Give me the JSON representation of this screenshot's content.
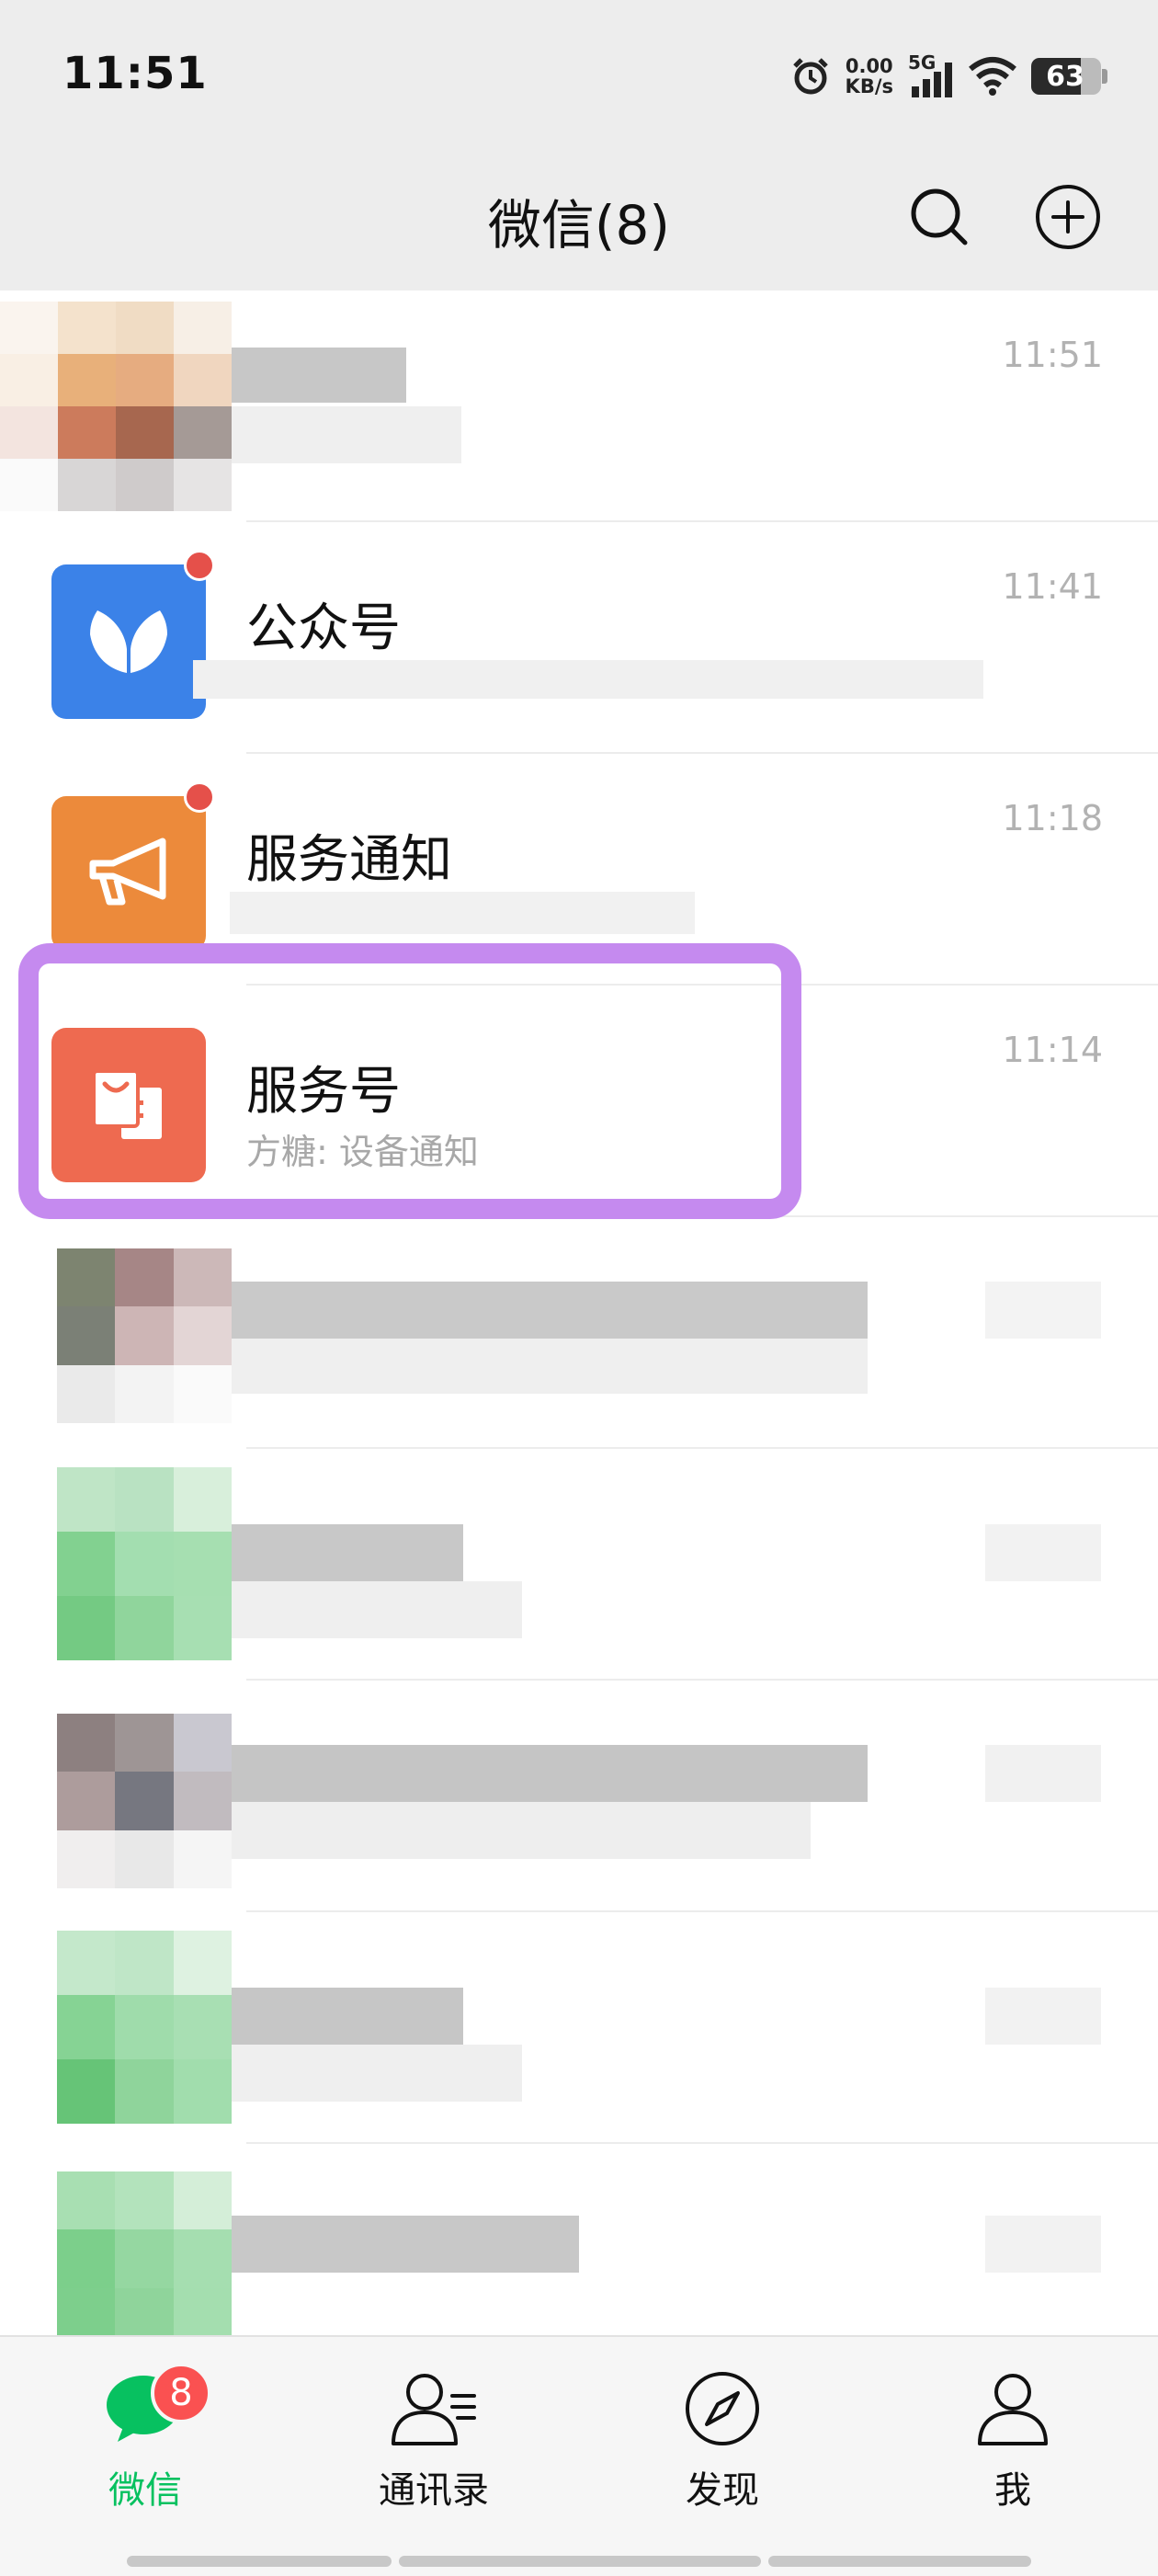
{
  "status_bar": {
    "time": "11:51",
    "net_speed_value": "0.00",
    "net_speed_unit": "KB/s",
    "network": "5G",
    "battery_level": "63"
  },
  "header": {
    "title": "微信(8)",
    "search_icon": "search-icon",
    "add_icon": "plus-circle-icon"
  },
  "chats": [
    {
      "name": "",
      "preview": "",
      "time": "11:51",
      "blurred": true
    },
    {
      "name": "公众号",
      "preview": "",
      "time": "11:41",
      "unread_dot": true,
      "avatar_color": "#3b82e8"
    },
    {
      "name": "服务通知",
      "preview": "",
      "time": "11:18",
      "unread_dot": true,
      "avatar_color": "#ec8a3b"
    },
    {
      "name": "服务号",
      "preview": "方糖: 设备通知",
      "time": "11:14",
      "avatar_color": "#ee6a50",
      "highlighted": true
    },
    {
      "name": "",
      "preview": "",
      "time": "",
      "blurred": true
    },
    {
      "name": "",
      "preview": "",
      "time": "",
      "blurred": true
    },
    {
      "name": "",
      "preview": "",
      "time": "",
      "blurred": true
    },
    {
      "name": "",
      "preview": "",
      "time": "",
      "blurred": true
    },
    {
      "name": "",
      "preview": "",
      "time": "",
      "blurred": true
    }
  ],
  "tabs": [
    {
      "label": "微信",
      "icon": "chat-bubble-icon",
      "active": true,
      "badge": "8"
    },
    {
      "label": "通讯录",
      "icon": "contacts-icon"
    },
    {
      "label": "发现",
      "icon": "compass-icon"
    },
    {
      "label": "我",
      "icon": "person-icon"
    }
  ],
  "colors": {
    "accent": "#07c160",
    "highlight_border": "#c58aef",
    "badge": "#fa5151"
  }
}
